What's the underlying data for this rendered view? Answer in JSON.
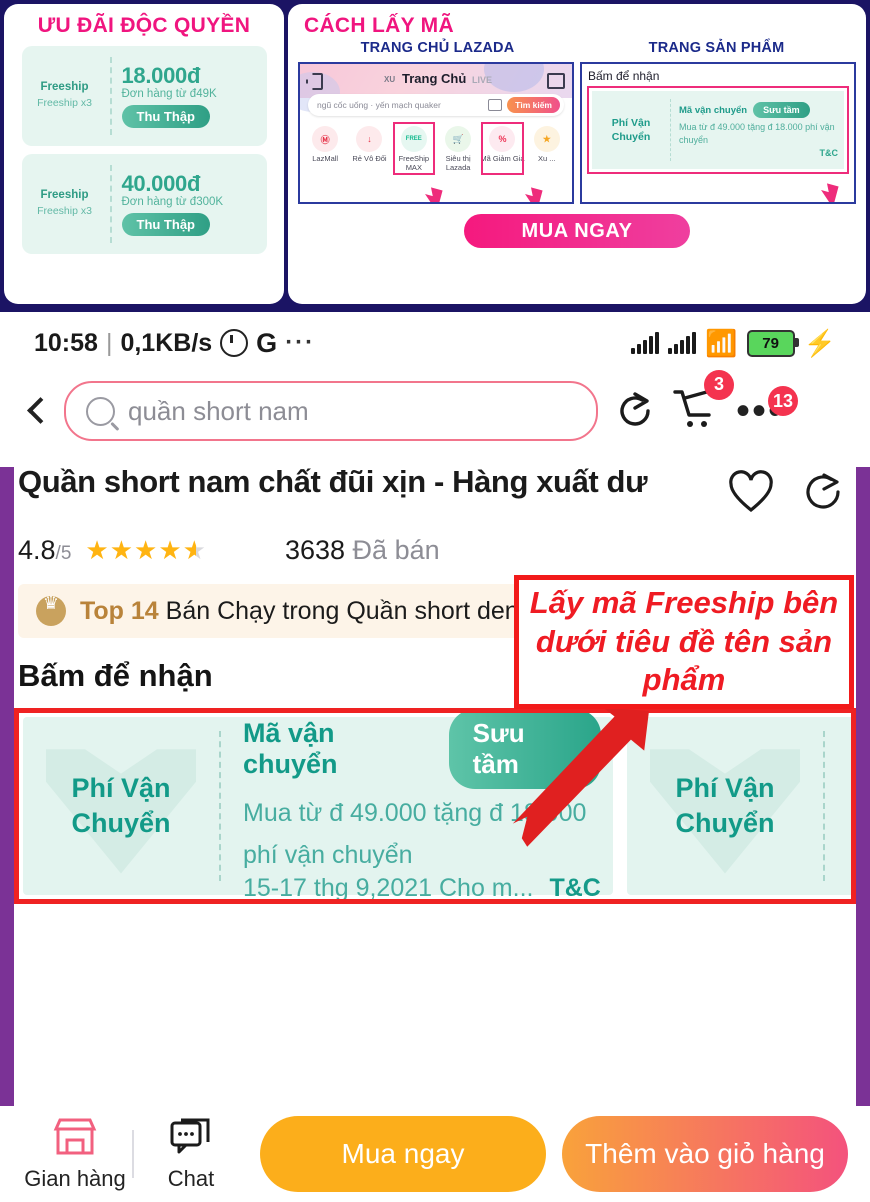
{
  "banner": {
    "left": {
      "title": "ƯU ĐÃI ĐỘC QUYỀN",
      "coupons": [
        {
          "brand": "Freeship",
          "sub": "Freeship x3",
          "amount": "18.000đ",
          "condition": "Đơn hàng từ đ49K",
          "button": "Thu Thập"
        },
        {
          "brand": "Freeship",
          "sub": "Freeship x3",
          "amount": "40.000đ",
          "condition": "Đơn hàng từ đ300K",
          "button": "Thu Thập"
        }
      ]
    },
    "right": {
      "title": "CÁCH LẤY MÃ",
      "sub_headings": [
        "TRANG CHỦ LAZADA",
        "TRANG SẢN PHẨM"
      ],
      "home_mock": {
        "xu_label": "XU",
        "page_label": "Trang Chủ",
        "live_label": "LIVE",
        "search_value": "ngũ cốc uống · yến mạch quaker",
        "search_button": "Tìm kiếm",
        "categories": [
          {
            "label": "LazMall",
            "glyph": "Ⓜ",
            "color": "#e53046",
            "highlight": false
          },
          {
            "label": "Rẻ Vô Đối",
            "glyph": "↓",
            "color": "#e53046",
            "highlight": false
          },
          {
            "label": "FreeShip MAX",
            "glyph": "FREE",
            "color": "#19c79b",
            "highlight": true
          },
          {
            "label": "Siêu thị Lazada",
            "glyph": "🛒",
            "color": "#37b44a",
            "highlight": false
          },
          {
            "label": "Mã Giảm Giá",
            "glyph": "%",
            "color": "#ee3355",
            "highlight": true
          },
          {
            "label": "Xu ...",
            "glyph": "★",
            "color": "#f5a623",
            "highlight": false
          }
        ]
      },
      "product_mock": {
        "section_title": "Bấm để nhận",
        "voucher": {
          "left_text": "Phí Vận Chuyển",
          "label": "Mã vận chuyển",
          "button": "Sưu tầm",
          "desc": "Mua từ đ 49.000 tặng đ 18.000 phí vận chuyển",
          "tc": "T&C"
        }
      },
      "cta": "MUA NGAY"
    }
  },
  "phone": {
    "status": {
      "time": "10:58",
      "separator": "|",
      "netspeed": "0,1KB/s",
      "alarm_icon": "alarm-icon",
      "google_icon": "G",
      "more_icon": "···",
      "battery": "79"
    },
    "searchbar": {
      "back_icon": "back-chevron-icon",
      "search_icon": "search-icon",
      "query": "quần short nam",
      "share_icon": "share-icon",
      "cart_icon": "cart-icon",
      "cart_badge": "3",
      "menu_icon": "kebab-menu-icon",
      "menu_badge": "13"
    },
    "product": {
      "title": "Quần short nam chất đũi xịn - Hàng xuất dư",
      "wishlist_icon": "heart-icon",
      "share_icon": "share-icon",
      "rating": "4.8",
      "rating_max": "/5",
      "stars": "★★★★",
      "half_star": "★",
      "sold_count": "3638",
      "sold_label": "Đã bán"
    },
    "top_badge": {
      "crown_icon": "crown-icon",
      "rank": "Top 14",
      "text": "Bán Chạy trong Quần short denim nam"
    },
    "voucher_section": {
      "title": "Bấm để nhận",
      "chevron_icon": "chevron-right-icon",
      "cards": [
        {
          "left_text": "Phí Vận Chuyển",
          "label": "Mã vận chuyển",
          "button": "Sưu tầm",
          "desc_line1": "Mua từ đ 49.000 tặng đ 18.000",
          "desc_line2": "phí vận chuyển",
          "date": "15-17 thg 9,2021 Cho m...",
          "tc": "T&C"
        },
        {
          "left_text": "Phí Vận Chuyển"
        }
      ]
    },
    "bottombar": {
      "shop": {
        "icon": "store-icon",
        "label": "Gian hàng"
      },
      "chat": {
        "icon": "chat-icon",
        "label": "Chat"
      },
      "buy_now": "Mua ngay",
      "add_cart": "Thêm vào giỏ hàng"
    }
  },
  "annotation": {
    "callout_text": "Lấy mã Freeship bên dưới tiêu đề tên sản phẩm",
    "arrow_icon": "red-arrow-icon",
    "color": "#ef1b23"
  }
}
